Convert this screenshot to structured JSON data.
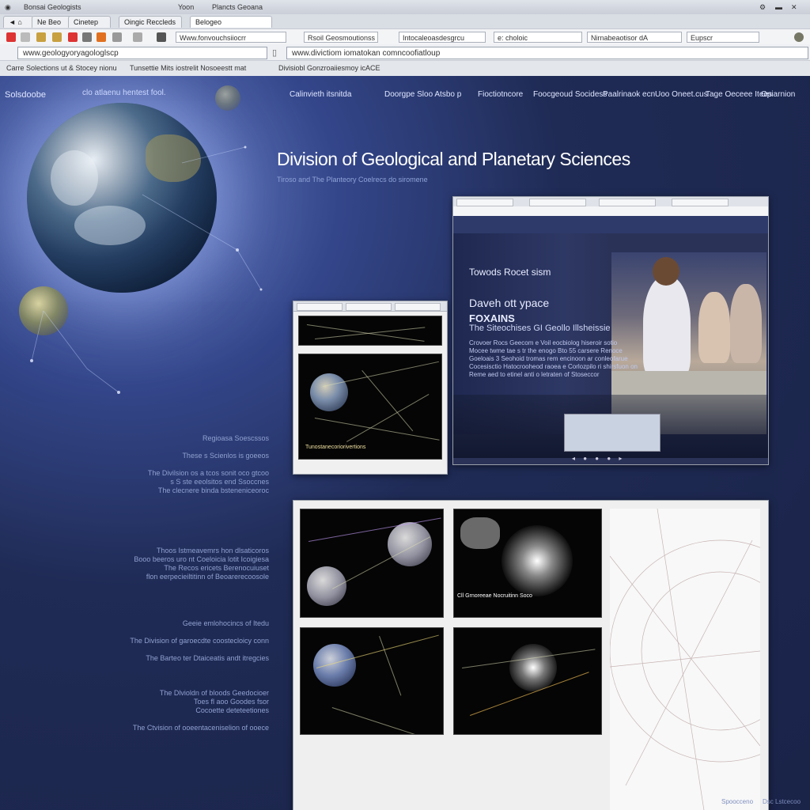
{
  "browser": {
    "titlebar": [
      "Bonsai Geologists",
      "Yoon",
      "Plancts Geoana"
    ],
    "tabs": [
      "Ne Beo",
      "Cinetep",
      "Oingic Reccleds",
      "Belogeo"
    ],
    "toolbar_fields": [
      "Www.fonvouchsiiocrr",
      "Rsoil Geosmoutionss",
      "Intocaleoasdesgrcu",
      "e: choloic",
      "Nirnabeaotisor dA",
      "Eupscr"
    ],
    "address_left": "www.geologyoryagologlscp",
    "address_right": "www.divictiom iomatokan comncoofiatloup",
    "bookmarks": [
      "Carre Solections ut & Stocey nionu",
      "Tunsettie Mits iostrelit Nosoeestt mat",
      "Divisiobl Gonzroaiiesmoy icACE"
    ]
  },
  "nav": {
    "logo": "Solsdoobe",
    "tagline": "clo atlaenu hentest fool.",
    "links": [
      "Calinvieth itsnitda",
      "Doorgpe Sloo Atsbo p",
      "Fioctiotncore",
      "Foocgeoud Socidess",
      "Paalrinaok ecn",
      "Uoo Oneet.cus",
      "Tage Oeceee Itees",
      "Opiarnion"
    ]
  },
  "hero": {
    "title": "Division of Geological and Planetary Sciences",
    "subtitle": "Tiroso and The Planteory Coelrecs do siromene"
  },
  "featured": {
    "caption_top": "Towods Rocet sism",
    "headline": "Daveh ott ypace",
    "sub_headline": "FOXAINS",
    "subtitle": "The Siteochises GI Geollo Illsheissie",
    "paragraph": [
      "Crovoer Rocs Geecom e Voil eocbiolog hiseroir sotio",
      "Mocee twme tae s tr the enogo Bto 55 carsere Renoce",
      "Goeloais 3 Seohoid tromas rem encinoon ar conleofarue",
      "Cocesisctio Hatocrooheod raoea e Corlozpilo ri shirsfuon on",
      "Reme aed to etinel anti o letraten of Stoseccor"
    ]
  },
  "small_shot": {
    "legend": "Tunostanecoriorivertions"
  },
  "gallery": {
    "caption": "Cll Grnoreeae Nocruitinn Soco"
  },
  "sidebar_text": [
    "Regioasa Soescssos",
    "These s Scienlos is goeeos",
    "The Divilsion os a tcos sonit oco gtcoo",
    "s S ste eeolsitos end Ssoccnes",
    "The clecnere binda bsteneniceoroc",
    "Thoos Istmeavemrs hon dlsaticoros",
    "Booo beeros uro nt Coeloicia lotit Icoigiesa",
    "The Recos ericets Berenocuiuset",
    "flon eerpecieiltitinn of Beoarerecoosole",
    "Geeie emlohocincs of Itedu",
    "The Division of garoecdte coostecloicy conn",
    "The Barteo ter Dtaiceatis andt itregcies",
    "The Dlvioldn of bloods Geedocioer",
    "Toes fl aoo Goodes fsor",
    "Cocoette deteteetiones",
    "The Ctvision of ooeentaceniselion of ooece"
  ],
  "footer": [
    "Spoocceno",
    "Dsc Lstcecoo"
  ]
}
